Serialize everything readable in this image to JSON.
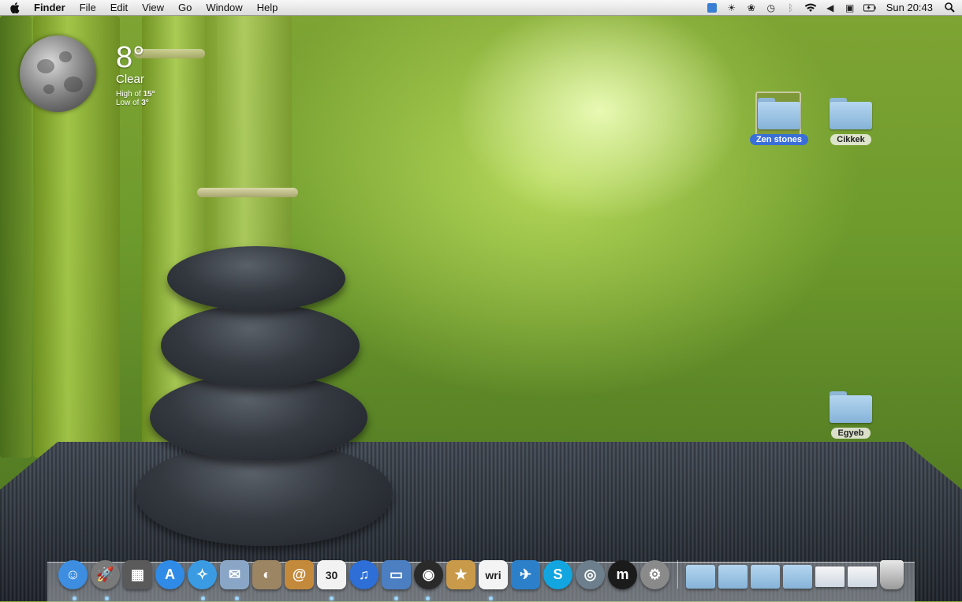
{
  "menubar": {
    "app_name": "Finder",
    "menus": [
      "File",
      "Edit",
      "View",
      "Go",
      "Window",
      "Help"
    ],
    "clock": "Sun 20:43",
    "status_icons": [
      "dropbox-icon",
      "brightness-icon",
      "paw-icon",
      "time-machine-icon",
      "bluetooth-icon",
      "wifi-icon",
      "volume-icon",
      "display-icon",
      "battery-icon",
      "spotlight-icon"
    ]
  },
  "weather": {
    "temperature": "8°",
    "condition": "Clear",
    "high_label": "High of",
    "high_value": "15°",
    "low_label": "Low of",
    "low_value": "3°"
  },
  "desktop": {
    "icons": [
      {
        "label": "Zen stones",
        "selected": true
      },
      {
        "label": "Cikkek",
        "selected": false
      },
      {
        "label": "Egyeb",
        "selected": false
      }
    ]
  },
  "dock": {
    "apps": [
      {
        "name": "finder-icon",
        "glyph": "☺",
        "color": "#3d8ee0"
      },
      {
        "name": "launchpad-icon",
        "glyph": "🚀",
        "color": "#7a7a7a"
      },
      {
        "name": "mission-control-icon",
        "glyph": "▦",
        "color": "#5a5a5a"
      },
      {
        "name": "app-store-icon",
        "glyph": "A",
        "color": "#2f8be6"
      },
      {
        "name": "safari-icon",
        "glyph": "✧",
        "color": "#3a9be3"
      },
      {
        "name": "mail-icon",
        "glyph": "✉",
        "color": "#8aa6c6"
      },
      {
        "name": "preview-icon",
        "glyph": "◐",
        "color": "#9c8563"
      },
      {
        "name": "contacts-icon",
        "glyph": "@",
        "color": "#c48a3c"
      },
      {
        "name": "calendar-icon",
        "glyph": "30",
        "color": "#f2f2f2"
      },
      {
        "name": "itunes-icon",
        "glyph": "♫",
        "color": "#2d6fd6"
      },
      {
        "name": "parallels-icon",
        "glyph": "▭",
        "color": "#4b7fc2"
      },
      {
        "name": "photo-booth-icon",
        "glyph": "◉",
        "color": "#2a2a2a"
      },
      {
        "name": "package-icon",
        "glyph": "★",
        "color": "#c99a4a"
      },
      {
        "name": "write-icon",
        "glyph": "wri",
        "color": "#f4f4f4"
      },
      {
        "name": "twitter-icon",
        "glyph": "✈",
        "color": "#2b80c9"
      },
      {
        "name": "skype-icon",
        "glyph": "S",
        "color": "#12a5e0"
      },
      {
        "name": "network-icon",
        "glyph": "◎",
        "color": "#6d7f8c"
      },
      {
        "name": "m-app-icon",
        "glyph": "m",
        "color": "#1b1b1b"
      },
      {
        "name": "system-preferences-icon",
        "glyph": "⚙",
        "color": "#8a8a8a"
      }
    ],
    "stacks": [
      {
        "name": "applications-folder-icon"
      },
      {
        "name": "documents-folder-icon"
      },
      {
        "name": "files-folder-icon"
      },
      {
        "name": "downloads-folder-icon"
      },
      {
        "name": "screenshot-stack-icon"
      },
      {
        "name": "preview-stack-icon"
      },
      {
        "name": "trash-icon"
      }
    ]
  }
}
